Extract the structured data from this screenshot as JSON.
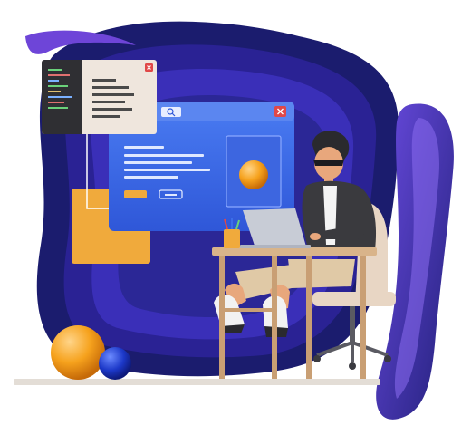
{
  "scene": {
    "subject": "developer-at-laptop",
    "colors": {
      "backdrop_outer": "#1b1c6e",
      "backdrop_mid": "#2a2294",
      "backdrop_inner": "#3a2fb8",
      "accent_purple": "#6e45d8",
      "window_blue": "#3c6ee8",
      "window_blue_light": "#5b86f0",
      "card_orange": "#f0aa3c",
      "panel_beige": "#efe6dd",
      "code_bg": "#2f2f33",
      "close_red": "#e04848",
      "ball_orange": "#f6a21d",
      "ball_blue": "#1c38c8",
      "desk_wood": "#d9b48a",
      "chair_beige": "#e8d6c4",
      "floor": "#e3ddd6"
    }
  },
  "icons": {
    "search": "search-icon",
    "close": "close-icon"
  }
}
